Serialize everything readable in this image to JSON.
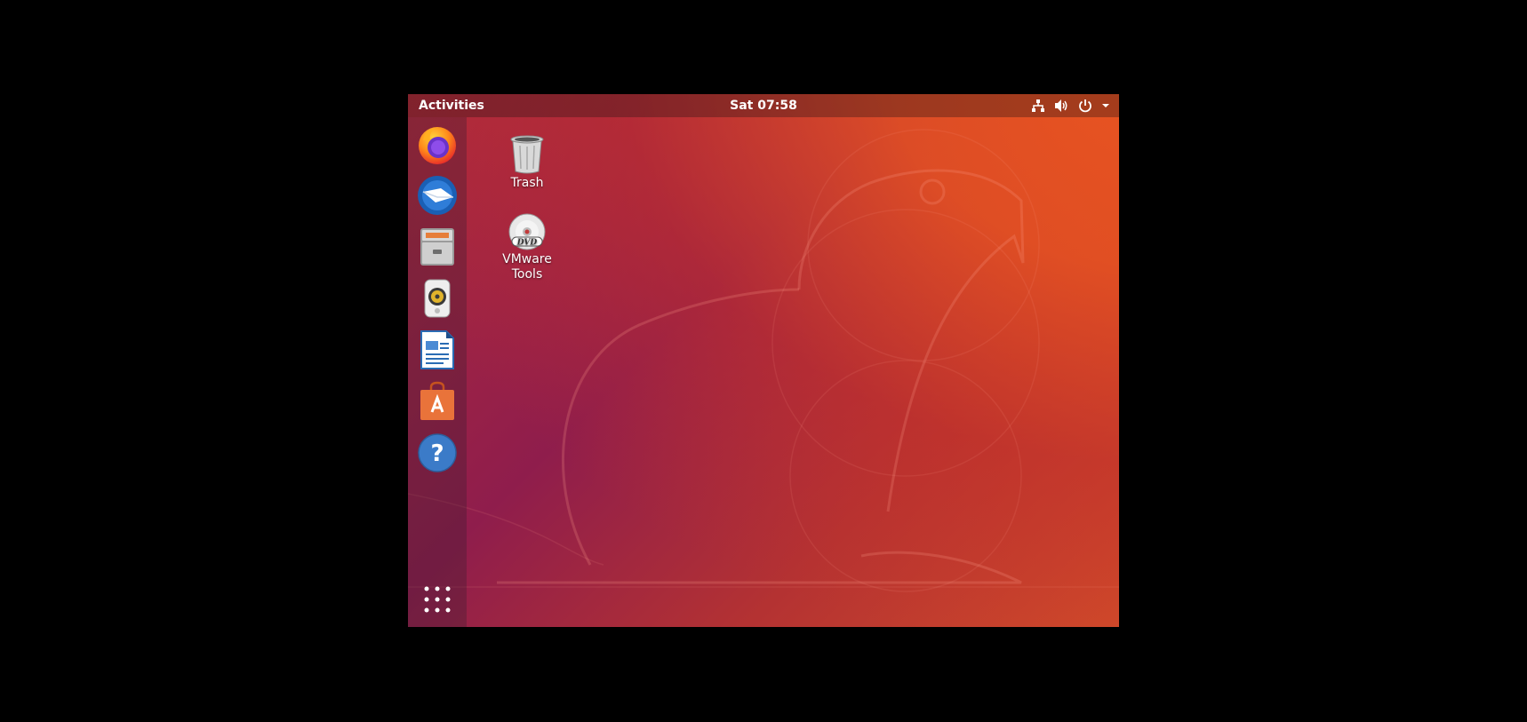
{
  "topbar": {
    "activities_label": "Activities",
    "clock": "Sat 07:58",
    "tray_icons": [
      "network-icon",
      "volume-icon",
      "power-icon",
      "menu-arrow-icon"
    ]
  },
  "dock": {
    "items": [
      {
        "name": "Firefox",
        "icon": "firefox-icon"
      },
      {
        "name": "Thunderbird Mail",
        "icon": "thunderbird-icon"
      },
      {
        "name": "Files",
        "icon": "files-icon"
      },
      {
        "name": "Rhythmbox",
        "icon": "rhythmbox-icon"
      },
      {
        "name": "LibreOffice Writer",
        "icon": "writer-icon"
      },
      {
        "name": "Ubuntu Software",
        "icon": "software-icon"
      },
      {
        "name": "Help",
        "icon": "help-icon"
      }
    ],
    "show_apps_icon": "apps-grid-icon"
  },
  "desktop": {
    "icons": [
      {
        "label": "Trash",
        "icon": "trash-icon"
      },
      {
        "label": "VMware Tools",
        "icon": "dvd-icon"
      }
    ]
  },
  "colors": {
    "accent": "#e95420",
    "aubergine": "#772953"
  }
}
